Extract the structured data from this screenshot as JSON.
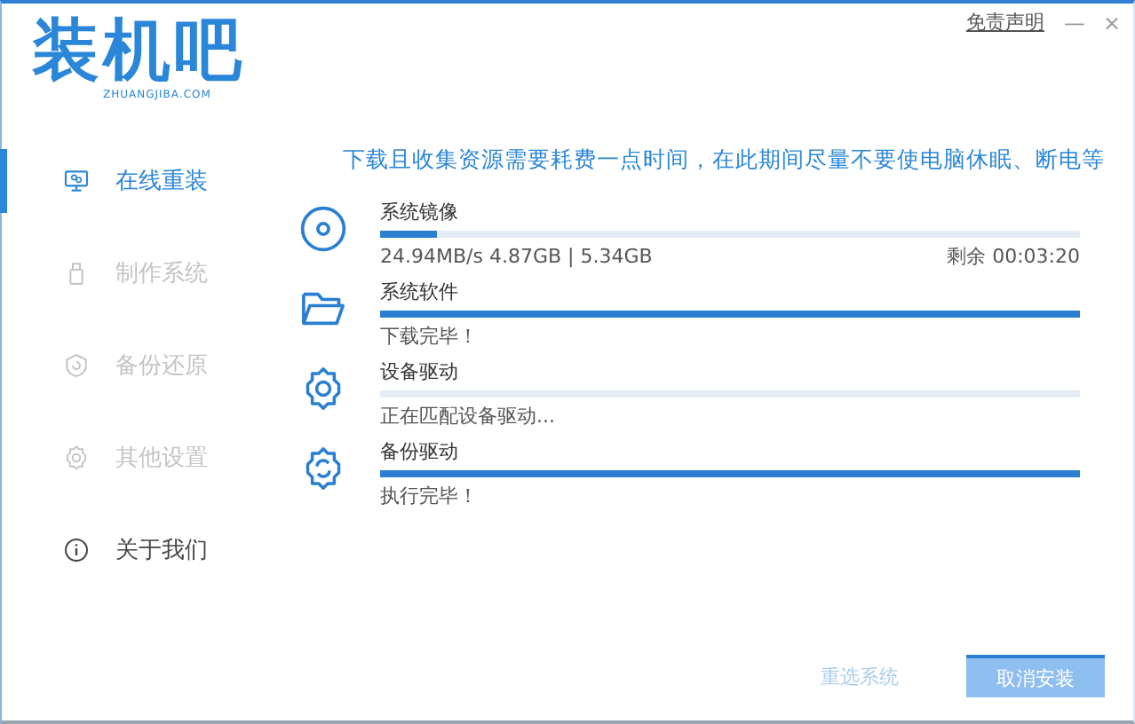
{
  "logo": {
    "title": "装机吧",
    "subtitle": "ZHUANGJIBA.COM"
  },
  "top_links": {
    "disclaimer": "免责声明",
    "minimize": "—",
    "close": "×"
  },
  "sidebar": {
    "items": [
      {
        "label": "在线重装",
        "selected": true,
        "disabled": false
      },
      {
        "label": "制作系统",
        "selected": false,
        "disabled": true
      },
      {
        "label": "备份还原",
        "selected": false,
        "disabled": true
      },
      {
        "label": "其他设置",
        "selected": false,
        "disabled": true
      },
      {
        "label": "关于我们",
        "selected": false,
        "disabled": false
      }
    ]
  },
  "notice": "下载且收集资源需要耗费一点时间，在此期间尽量不要使电脑休眠、断电等",
  "tasks": [
    {
      "name": "系统镜像",
      "level": 0.08,
      "status": "24.94MB/s 4.87GB | 5.34GB",
      "remaining": "剩余 00:03:20"
    },
    {
      "name": "系统软件",
      "level": 1,
      "status": "下载完毕！"
    },
    {
      "name": "设备驱动",
      "level": 0,
      "status": "正在匹配设备驱动..."
    },
    {
      "name": "备份驱动",
      "level": 1,
      "status": "执行完毕！"
    }
  ],
  "buttons": [
    {
      "label": "重选系统",
      "kind": "link",
      "disabled": true
    },
    {
      "label": "取消安装",
      "kind": "primary",
      "disabled": true
    }
  ]
}
